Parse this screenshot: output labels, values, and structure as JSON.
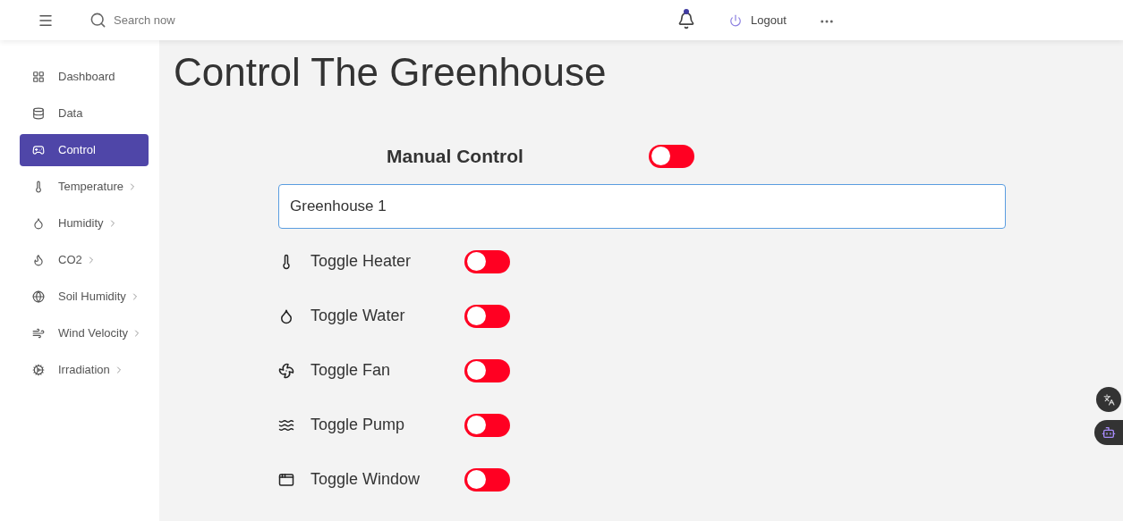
{
  "header": {
    "search": {
      "placeholder": "Search now"
    },
    "notification_dot": true,
    "logout": "Logout"
  },
  "sidebar": {
    "items": [
      {
        "label": "Dashboard",
        "selected": false,
        "submenu": false
      },
      {
        "label": "Data",
        "selected": false,
        "submenu": false
      },
      {
        "label": "Control",
        "selected": true,
        "submenu": false
      },
      {
        "label": "Temperature",
        "selected": false,
        "submenu": true
      },
      {
        "label": "Humidity",
        "selected": false,
        "submenu": true
      },
      {
        "label": "CO2",
        "selected": false,
        "submenu": true
      },
      {
        "label": "Soil Humidity",
        "selected": false,
        "submenu": true
      },
      {
        "label": "Wind Velocity",
        "selected": false,
        "submenu": true
      },
      {
        "label": "Irradiation",
        "selected": false,
        "submenu": true
      }
    ]
  },
  "page": {
    "title": "Control The Greenhouse",
    "manual_control": {
      "label": "Manual Control",
      "on": false
    },
    "greenhouse_field": {
      "value": "Greenhouse 1"
    },
    "toggles": [
      {
        "label": "Toggle Heater",
        "on": false
      },
      {
        "label": "Toggle Water",
        "on": false
      },
      {
        "label": "Toggle Fan",
        "on": false
      },
      {
        "label": "Toggle Pump",
        "on": false
      },
      {
        "label": "Toggle Window",
        "on": false
      }
    ]
  }
}
